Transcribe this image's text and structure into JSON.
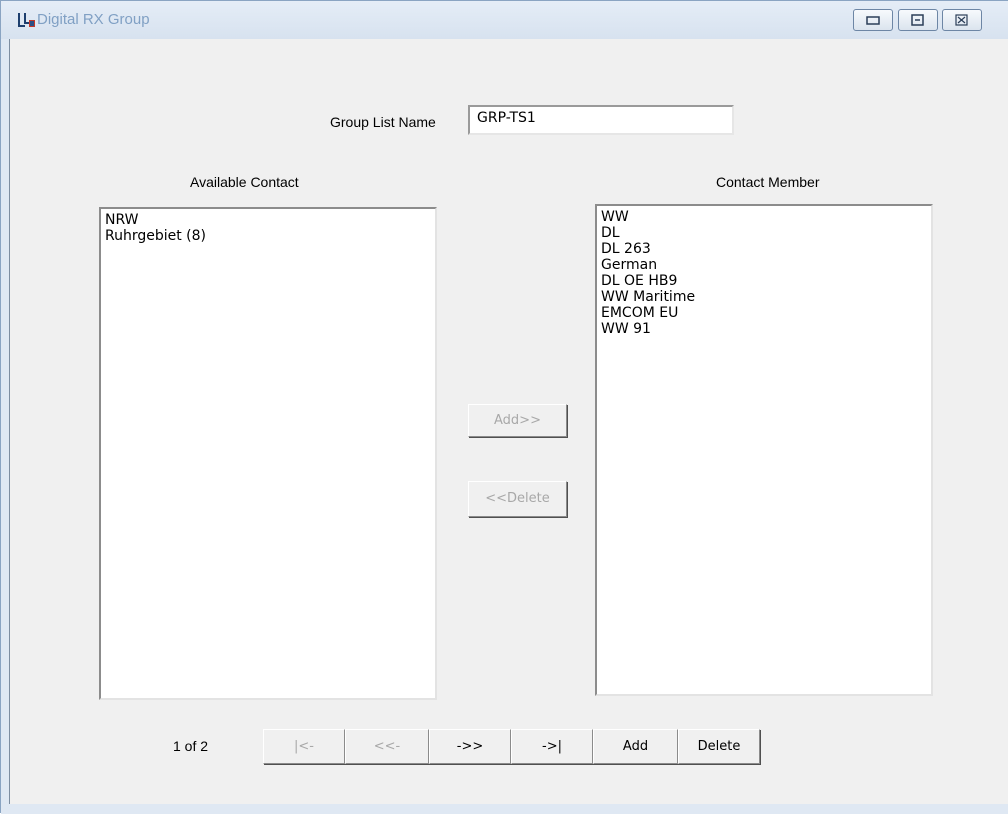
{
  "window": {
    "title": "Digital RX Group"
  },
  "form": {
    "group_list_name_label": "Group List Name",
    "group_list_name_value": "GRP-TS1"
  },
  "available": {
    "label": "Available Contact",
    "items": [
      "NRW",
      "Ruhrgebiet (8)"
    ]
  },
  "members": {
    "label": "Contact Member",
    "items": [
      "WW",
      "DL",
      "DL 263",
      "German",
      "DL OE HB9",
      "WW Maritime",
      "EMCOM EU",
      "WW 91"
    ]
  },
  "transfer": {
    "add_label": "Add>>",
    "delete_label": "<<Delete"
  },
  "nav": {
    "page_indicator": "1 of 2",
    "first_label": "|<-",
    "prev_label": "<<-",
    "next_label": "->>",
    "last_label": "->|",
    "add_label": "Add",
    "delete_label": "Delete"
  }
}
